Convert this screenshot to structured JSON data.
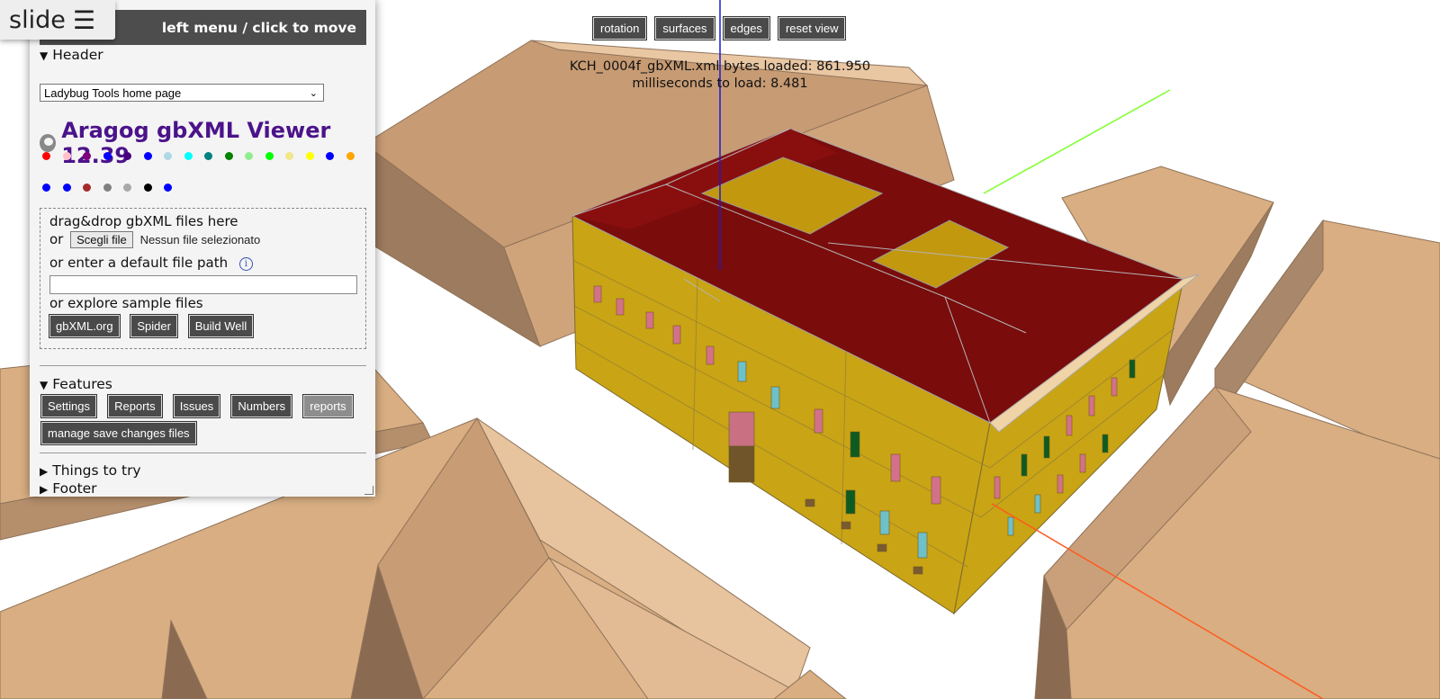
{
  "toolbar": {
    "rotation_label": "rotation",
    "surfaces_label": "surfaces",
    "edges_label": "edges",
    "reset_label": "reset view"
  },
  "load_info": {
    "bytes_line": "KCH_0004f_gbXML.xml bytes loaded: 861.950",
    "ms_line": "milliseconds to load: 8.481"
  },
  "slide": {
    "label": "slide",
    "icon": "☰"
  },
  "menu": {
    "title": "left menu / click to move",
    "header_summary": "Header",
    "home_select": "Ladybug Tools home page",
    "app_title": "Aragog gbXML Viewer 12.39",
    "color_dots": [
      "#ff0000",
      "#ffc0cb",
      "#800080",
      "#0000ff",
      "#4b0082",
      "#0000ff",
      "#add8e6",
      "#00ffff",
      "#008080",
      "#008000",
      "#90ee90",
      "#00ff00",
      "#f0e68c",
      "#ffff00",
      "#0000ff",
      "#ffa500",
      "#0000ff",
      "#0000ff",
      "#a52a2a",
      "#808080",
      "#a9a9a9",
      "#000000",
      "#0000ff"
    ],
    "drop": {
      "drag_text": "drag&drop gbXML files here",
      "or_text": "or",
      "choose_file": "Scegli file",
      "no_file": "Nessun file selezionato",
      "default_path_text": "or enter a default file path",
      "path_value": "",
      "explore_text": "or explore sample files",
      "samples": [
        "gbXML.org",
        "Spider",
        "Build Well"
      ]
    },
    "features_summary": "Features",
    "features": [
      "Settings",
      "Reports",
      "Issues",
      "Numbers",
      "reports"
    ],
    "manage_label": "manage save changes files",
    "things_summary": "Things to try",
    "footer_summary": "Footer"
  },
  "colors": {
    "panel_bg": "#f4f4f4",
    "button_dark": "#4a4a4a",
    "title_purple": "#4b138a",
    "roof_red": "#7a0c0c",
    "facade_yellow": "#c9a414",
    "context_tan": "#d8ae82",
    "axis_x": "#ff5a1f",
    "axis_y": "#7dff2a",
    "axis_z": "#1c1cc8"
  }
}
